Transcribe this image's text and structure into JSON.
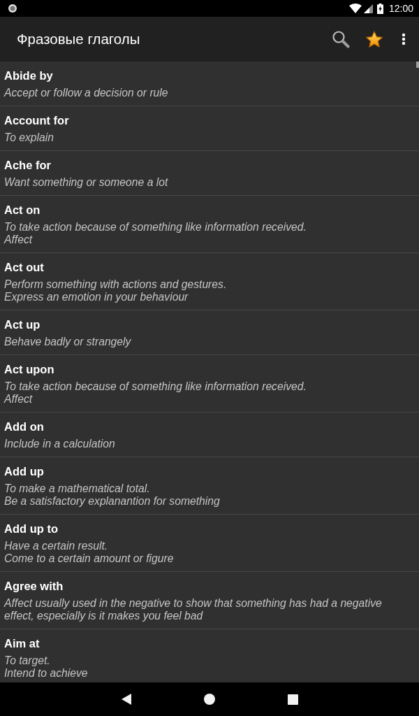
{
  "status_bar": {
    "time": "12:00"
  },
  "app_bar": {
    "title": "Фразовые глаголы"
  },
  "verbs": [
    {
      "phrase": "Abide by",
      "definition_lines": [
        "Accept or follow a decision or rule"
      ]
    },
    {
      "phrase": "Account for",
      "definition_lines": [
        "To explain"
      ]
    },
    {
      "phrase": "Ache for",
      "definition_lines": [
        "Want something or someone a lot"
      ]
    },
    {
      "phrase": "Act on",
      "definition_lines": [
        "To take action because of something like information received.",
        "Affect"
      ]
    },
    {
      "phrase": "Act out",
      "definition_lines": [
        "Perform something with actions and gestures.",
        "Express an emotion in your behaviour"
      ]
    },
    {
      "phrase": "Act up",
      "definition_lines": [
        "Behave badly or strangely"
      ]
    },
    {
      "phrase": "Act upon",
      "definition_lines": [
        "To take action because of something like information received.",
        "Affect"
      ]
    },
    {
      "phrase": "Add on",
      "definition_lines": [
        "Include in a calculation"
      ]
    },
    {
      "phrase": "Add up",
      "definition_lines": [
        "To make a mathematical total.",
        "Be a satisfactory explanantion for something"
      ]
    },
    {
      "phrase": "Add up to",
      "definition_lines": [
        "Have a certain result.",
        "Come to a certain amount or figure"
      ]
    },
    {
      "phrase": "Agree with",
      "definition_lines": [
        "Affect usually used in the negative to show that something has had a negative effect, especially is it makes you feel bad"
      ]
    },
    {
      "phrase": "Aim at",
      "definition_lines": [
        "To target.",
        "Intend to achieve"
      ]
    }
  ]
}
